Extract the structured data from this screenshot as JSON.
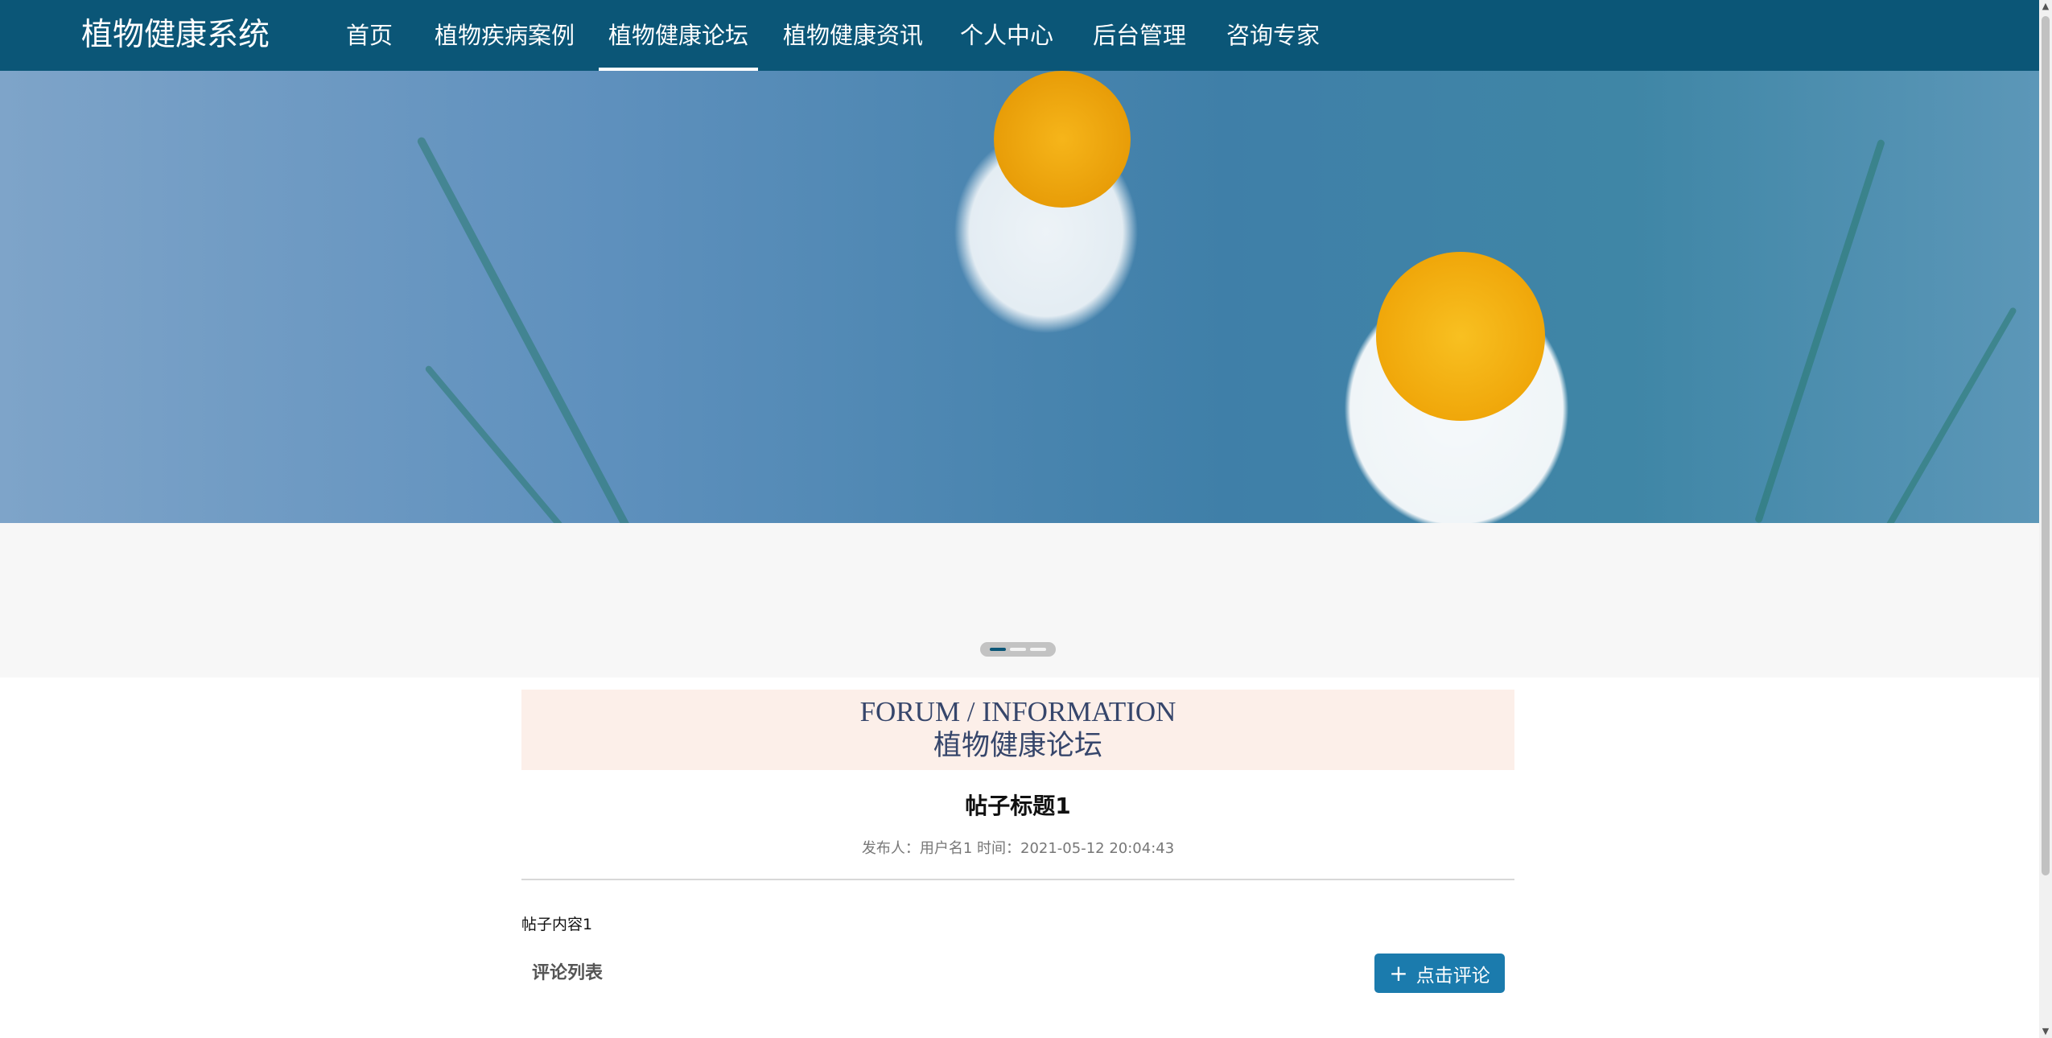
{
  "nav": {
    "brand": "植物健康系统",
    "items": [
      {
        "label": "首页"
      },
      {
        "label": "植物疾病案例"
      },
      {
        "label": "植物健康论坛"
      },
      {
        "label": "植物健康资讯"
      },
      {
        "label": "个人中心"
      },
      {
        "label": "后台管理"
      },
      {
        "label": "咨询专家"
      }
    ],
    "active_index": 2
  },
  "banner": {
    "slides": 3,
    "active_slide": 1
  },
  "forum": {
    "heading_en": "FORUM / INFORMATION",
    "heading_cn": "植物健康论坛"
  },
  "post": {
    "title": "帖子标题1",
    "meta": "发布人：用户名1 时间：2021-05-12 20:04:43",
    "content": "帖子内容1"
  },
  "comments": {
    "label": "评论列表",
    "button_label": "点击评论",
    "button_icon": "plus-icon"
  },
  "colors": {
    "nav_bg": "#0b5677",
    "header_bg": "#fcefe9",
    "button_bg": "#1b7bad",
    "heading_text": "#36466b"
  }
}
